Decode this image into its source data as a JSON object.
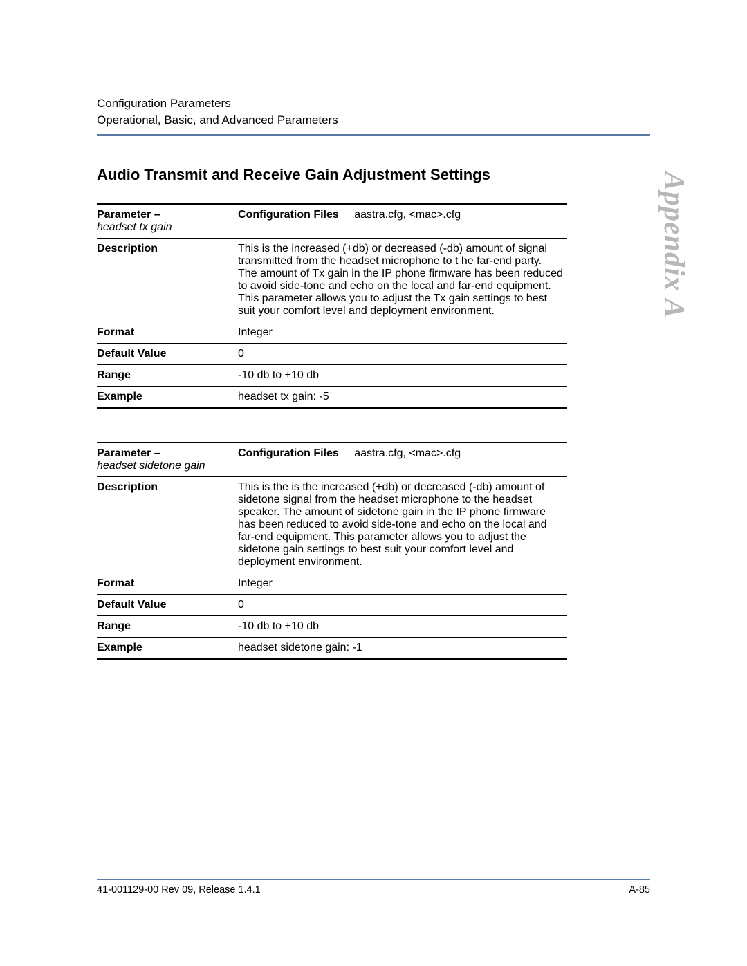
{
  "header": {
    "line1": "Configuration Parameters",
    "line2": "Operational, Basic, and Advanced Parameters"
  },
  "section_title": "Audio Transmit and Receive Gain Adjustment Settings",
  "side_label": "Appendix A",
  "tables": [
    {
      "parameter_label": "Parameter",
      "parameter_dash": " – ",
      "parameter_name": "headset tx gain",
      "config_files_label": "Configuration Files",
      "config_files_value": "aastra.cfg, <mac>.cfg",
      "rows": {
        "description_label": "Description",
        "description_value": "This is the increased (+db) or decreased (-db) amount of signal transmitted from the headset microphone to t he far-end party. The amount of Tx gain in the IP phone firmware has been reduced to avoid side-tone and echo on the local and far-end equipment. This parameter allows you to adjust the Tx gain settings to best suit your comfort level and deployment environment.",
        "format_label": "Format",
        "format_value": "Integer",
        "default_label": "Default Value",
        "default_value": "0",
        "range_label": "Range",
        "range_value": "-10 db to +10 db",
        "example_label": "Example",
        "example_value": "headset tx gain: -5"
      }
    },
    {
      "parameter_label": "Parameter",
      "parameter_dash": " – ",
      "parameter_name": "headset sidetone gain",
      "config_files_label": "Configuration Files",
      "config_files_value": "aastra.cfg, <mac>.cfg",
      "rows": {
        "description_label": "Description",
        "description_value": "This is the is the increased (+db) or decreased (-db) amount of sidetone signal from the headset microphone to the headset speaker. The amount of sidetone gain in the IP phone firmware has been reduced to avoid side-tone and echo on the local and far-end equipment. This parameter allows you to adjust the sidetone gain settings to best suit your comfort level and deployment environment.",
        "format_label": "Format",
        "format_value": "Integer",
        "default_label": "Default Value",
        "default_value": "0",
        "range_label": "Range",
        "range_value": "-10 db to +10 db",
        "example_label": "Example",
        "example_value": "headset sidetone gain: -1"
      }
    }
  ],
  "footer": {
    "left": "41-001129-00 Rev 09, Release 1.4.1",
    "right": "A-85"
  }
}
